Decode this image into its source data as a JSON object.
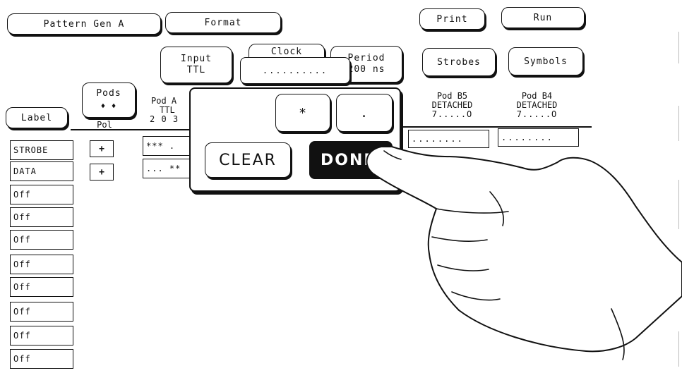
{
  "header": {
    "pattern_gen": "Pattern Gen A",
    "format": "Format",
    "print": "Print",
    "run": "Run"
  },
  "toolbar": {
    "input_label": "Input",
    "input_value": "TTL",
    "clock_label": "Clock",
    "period_label": "Period",
    "period_value": "200 ns",
    "strobes": "Strobes",
    "symbols": "Symbols",
    "edit_field_value": ".........."
  },
  "table": {
    "label_header": "Label",
    "pods_button": "Pods",
    "pods_arrows": "♦  ♦",
    "pol_header": "Pol",
    "pod_a_title": "Pod A",
    "pod_a_type": "TTL",
    "pod_a_bits": "2 0 3",
    "pod_b5_title": "Pod B5",
    "pod_b5_status": "DETACHED",
    "pod_b5_range": "7.....O",
    "pod_b4_title": "Pod B4",
    "pod_b4_status": "DETACHED",
    "pod_b4_range": "7.....O",
    "pod_b5_value": "........",
    "pod_b4_value": "........",
    "rows": [
      {
        "label": "STROBE",
        "pol": "+",
        "pod_a": "*** ."
      },
      {
        "label": "DATA",
        "pol": "+",
        "pod_a": "... **"
      },
      {
        "label": "Off"
      },
      {
        "label": "Off"
      },
      {
        "label": "Off"
      },
      {
        "label": "Off"
      },
      {
        "label": "Off"
      },
      {
        "label": "Off"
      },
      {
        "label": "Off"
      },
      {
        "label": "Off"
      }
    ]
  },
  "keypad": {
    "asterisk": "*",
    "dot": ".",
    "clear": "CLEAR",
    "done": "DONE"
  },
  "icons": {
    "hand": "pointing-hand-icon"
  }
}
